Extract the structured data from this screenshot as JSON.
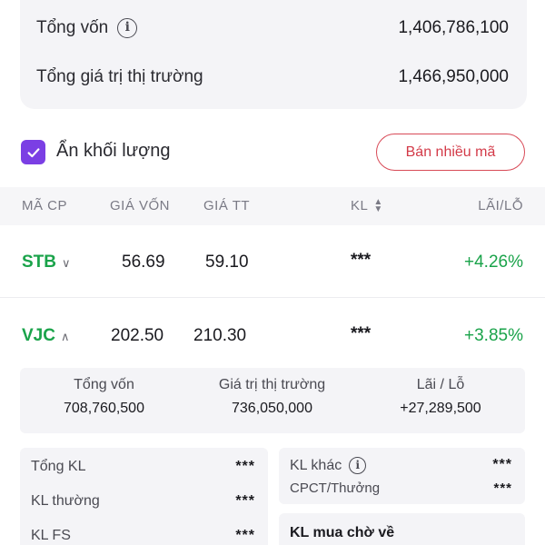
{
  "summary": {
    "total_capital_label": "Tổng vốn",
    "total_capital_value": "1,406,786,100",
    "market_value_label": "Tổng giá trị thị trường",
    "market_value_value": "1,466,950,000"
  },
  "controls": {
    "hide_volume_label": "Ẩn khối lượng",
    "hide_volume_checked": true,
    "sell_multiple_label": "Bán nhiều mã"
  },
  "table": {
    "headers": {
      "ticker": "MÃ CP",
      "cost_price": "GIÁ VỐN",
      "market_price": "GIÁ TT",
      "volume": "KL",
      "pnl": "LÃI/LỖ"
    },
    "rows": [
      {
        "ticker": "STB",
        "cost": "56.69",
        "market": "59.10",
        "volume": "***",
        "pnl": "+4.26%",
        "expanded": false
      },
      {
        "ticker": "VJC",
        "cost": "202.50",
        "market": "210.30",
        "volume": "***",
        "pnl": "+3.85%",
        "expanded": true
      }
    ]
  },
  "detail": {
    "capital_label": "Tổng vốn",
    "capital_value": "708,760,500",
    "market_label": "Giá trị thị trường",
    "market_value": "736,050,000",
    "pnl_label": "Lãi / Lỗ",
    "pnl_value": "+27,289,500",
    "left": [
      {
        "label": "Tổng KL",
        "value": "***"
      },
      {
        "label": "KL thường",
        "value": "***"
      },
      {
        "label": "KL FS",
        "value": "***"
      }
    ],
    "right": [
      {
        "label": "KL khác",
        "value": "***"
      },
      {
        "label": "CPCT/Thưởng",
        "value": "***"
      }
    ],
    "pending_label": "KL mua chờ về"
  },
  "colors": {
    "accent_purple": "#7b3fe4",
    "gain_green": "#1aa34a",
    "sell_red": "#d33a48"
  },
  "icons": {
    "info": "info-icon",
    "check": "check-icon",
    "chevron_down": "chevron-down-icon",
    "chevron_up": "chevron-up-icon",
    "sort": "sort-icon"
  }
}
